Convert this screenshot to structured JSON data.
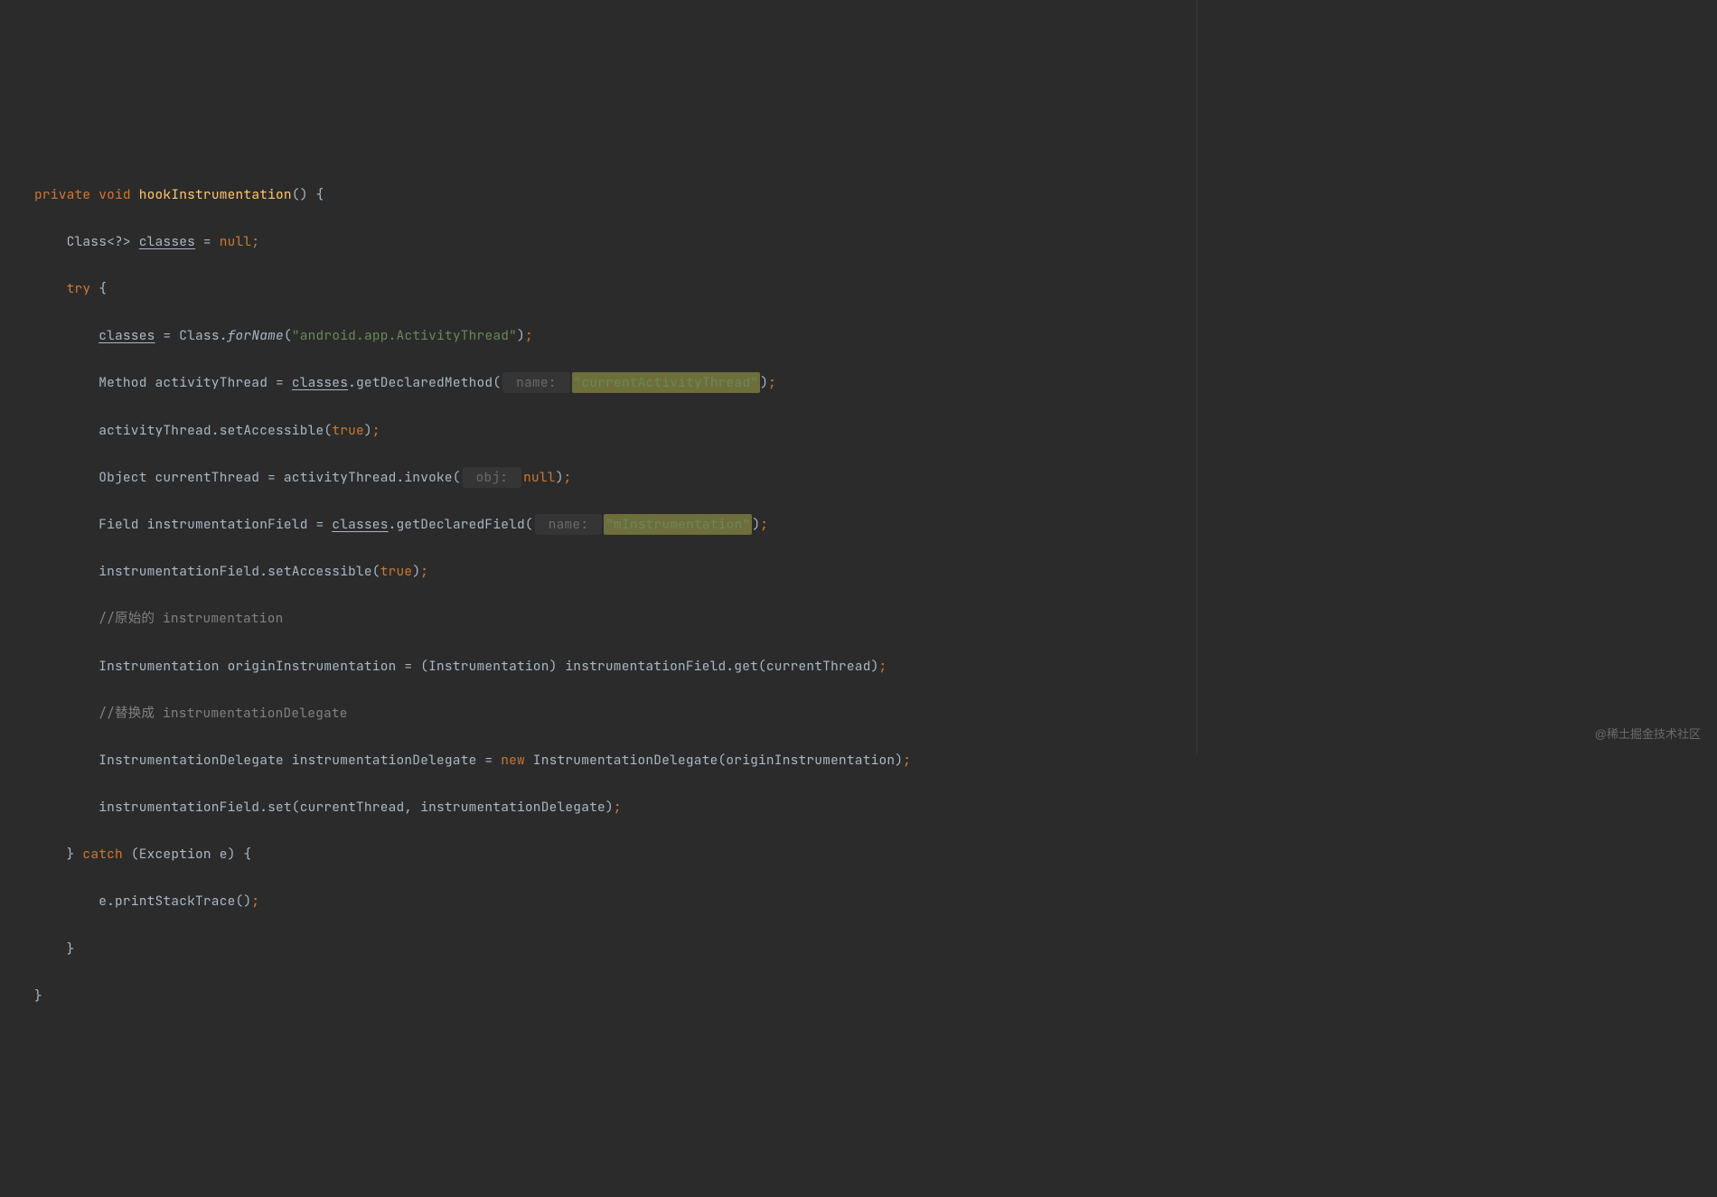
{
  "code": {
    "l1": {
      "private": "private",
      "void": "void",
      "name": "hookInstrumentation",
      "paren": "() {"
    },
    "l2": {
      "type": "Class<?> ",
      "var": "classes",
      "assign": " = ",
      "null": "null",
      "semi": ";"
    },
    "l3": {
      "try": "try",
      "brace": " {"
    },
    "l4": {
      "var": "classes",
      "assign": " = Class.",
      "static": "forName",
      "open": "(",
      "str": "\"android.app.ActivityThread\"",
      "close": ")",
      "semi": ";"
    },
    "l5": {
      "type": "Method activityThread = ",
      "var": "classes",
      "call": ".getDeclaredMethod(",
      "hint": " name: ",
      "str": "\"currentActivityThread\"",
      "close": ")",
      "semi": ";"
    },
    "l6": {
      "text": "activityThread.setAccessible(",
      "bool": "true",
      "close": ")",
      "semi": ";"
    },
    "l7": {
      "text": "Object currentThread = activityThread.invoke(",
      "hint": " obj: ",
      "null": "null",
      "close": ")",
      "semi": ";"
    },
    "l8": {
      "text": "Field instrumentationField = ",
      "var": "classes",
      "call": ".getDeclaredField(",
      "hint": " name: ",
      "str": "\"mInstrumentation\"",
      "close": ")",
      "semi": ";"
    },
    "l9": {
      "text": "instrumentationField.setAccessible(",
      "bool": "true",
      "close": ")",
      "semi": ";"
    },
    "l10": {
      "comment": "//原始的 instrumentation"
    },
    "l11": {
      "text": "Instrumentation originInstrumentation = (Instrumentation) instrumentationField.get(currentThread)",
      "semi": ";"
    },
    "l12": {
      "comment": "//替换成 instrumentationDelegate"
    },
    "l13": {
      "text1": "InstrumentationDelegate instrumentationDelegate = ",
      "new": "new",
      "text2": " InstrumentationDelegate(originInstrumentation)",
      "semi": ";"
    },
    "l14": {
      "text": "instrumentationField.set(currentThread, instrumentationDelegate)",
      "semi": ";"
    },
    "l15": {
      "close": "} ",
      "catch": "catch",
      "text": " (Exception e) {"
    },
    "l16": {
      "text": "e.printStackTrace()",
      "semi": ";"
    },
    "l17": {
      "brace": "}"
    },
    "l18": {
      "brace": "}"
    }
  },
  "watermark": "@稀土掘金技术社区"
}
